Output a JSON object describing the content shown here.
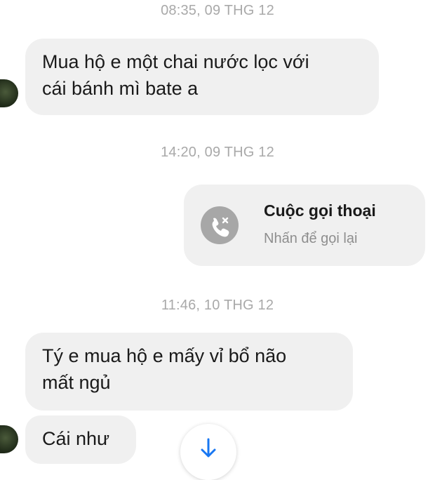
{
  "conversation": {
    "timestamps": {
      "t1": "08:35, 09 THG 12",
      "t2": "14:20, 09 THG 12",
      "t3": "11:46, 10 THG 12"
    },
    "messages": [
      {
        "line1": "Mua hộ e một chai nước lọc với",
        "line2": "cái bánh mì bate a"
      },
      {
        "line1": "Tý e mua hộ e mấy vỉ bổ não",
        "line2": "mất ngủ"
      },
      {
        "line1": "Cái như"
      }
    ],
    "call": {
      "title": "Cuộc gọi thoại",
      "subtitle": "Nhấn để gọi lại",
      "icon": "missed-call-icon"
    },
    "scroll_icon": "arrow-down-icon"
  },
  "colors": {
    "bubble": "#f0f0f0",
    "timestamp": "#a9a9a9",
    "accent": "#1877f2",
    "call_icon_bg": "#a7a7a7"
  }
}
